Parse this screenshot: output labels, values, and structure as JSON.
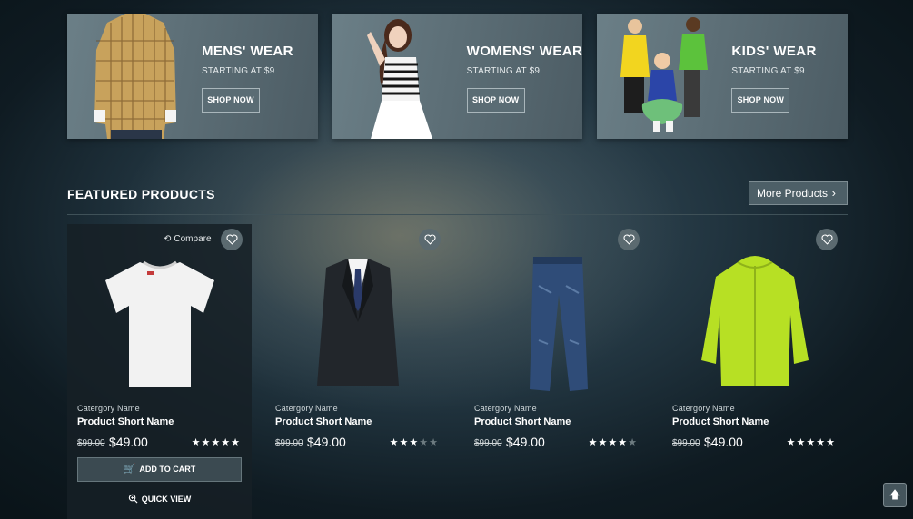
{
  "banners": [
    {
      "title": "MENS' WEAR",
      "subtitle": "STARTING AT $9",
      "button": "SHOP NOW"
    },
    {
      "title": "WOMENS' WEAR",
      "subtitle": "STARTING AT $9",
      "button": "SHOP NOW"
    },
    {
      "title": "KIDS' WEAR",
      "subtitle": "STARTING AT $9",
      "button": "SHOP NOW"
    }
  ],
  "section": {
    "title": "FEATURED PRODUCTS",
    "more_label": "More Products"
  },
  "products": [
    {
      "category": "Catergory Name",
      "name": "Product Short Name",
      "old_price": "$99.00",
      "price": "$49.00",
      "rating": 5,
      "compare_label": "Compare",
      "cart_label": "ADD TO CART",
      "quick_view_label": "QUICK VIEW"
    },
    {
      "category": "Catergory Name",
      "name": "Product Short Name",
      "old_price": "$99.00",
      "price": "$49.00",
      "rating": 3
    },
    {
      "category": "Catergory Name",
      "name": "Product Short Name",
      "old_price": "$99.00",
      "price": "$49.00",
      "rating": 4
    },
    {
      "category": "Catergory Name",
      "name": "Product Short Name",
      "old_price": "$99.00",
      "price": "$49.00",
      "rating": 5
    }
  ],
  "icons": {
    "wishlist": "heart-icon",
    "compare": "repeat-icon",
    "cart": "cart-icon",
    "quick_view": "zoom-icon",
    "scroll_top": "arrow-up-icon",
    "more": "chevron-right-icon"
  },
  "colors": {
    "accent": "#4d5f67",
    "star_on": "#ffffff",
    "star_off": "#6d7b80"
  }
}
